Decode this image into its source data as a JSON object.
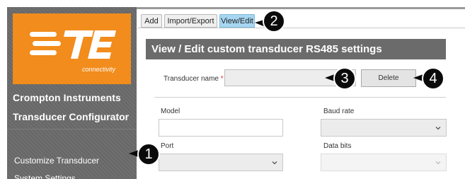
{
  "sidebar": {
    "logo": {
      "wordmark": "TE",
      "tagline": "connectivity",
      "color": "#f28c1c"
    },
    "brand_title": "Crompton Instruments",
    "brand_subtitle": "Transducer Configurator",
    "nav": [
      {
        "label": "Customize Transducer"
      },
      {
        "label": "System Settings"
      }
    ]
  },
  "tabs": [
    {
      "label": "Add",
      "active": false
    },
    {
      "label": "Import/Export",
      "active": false
    },
    {
      "label": "View/Edit",
      "active": true
    }
  ],
  "header": {
    "title": "View / Edit custom transducer RS485 settings"
  },
  "transducer_name": {
    "label": "Transducer name",
    "required_mark": "*",
    "value": "",
    "delete_label": "Delete"
  },
  "form": {
    "model": {
      "label": "Model",
      "value": ""
    },
    "baud_rate": {
      "label": "Baud rate",
      "selected": ""
    },
    "port": {
      "label": "Port",
      "selected": ""
    },
    "data_bits": {
      "label": "Data bits",
      "selected": "",
      "disabled": true
    }
  },
  "callouts": [
    "1",
    "2",
    "3",
    "4"
  ],
  "colors": {
    "accent_tab": "#a6d6f2",
    "header_bg": "#6b6b6b",
    "sidebar_bg": "#6a6a6a",
    "callout": "#0a0a0a"
  }
}
